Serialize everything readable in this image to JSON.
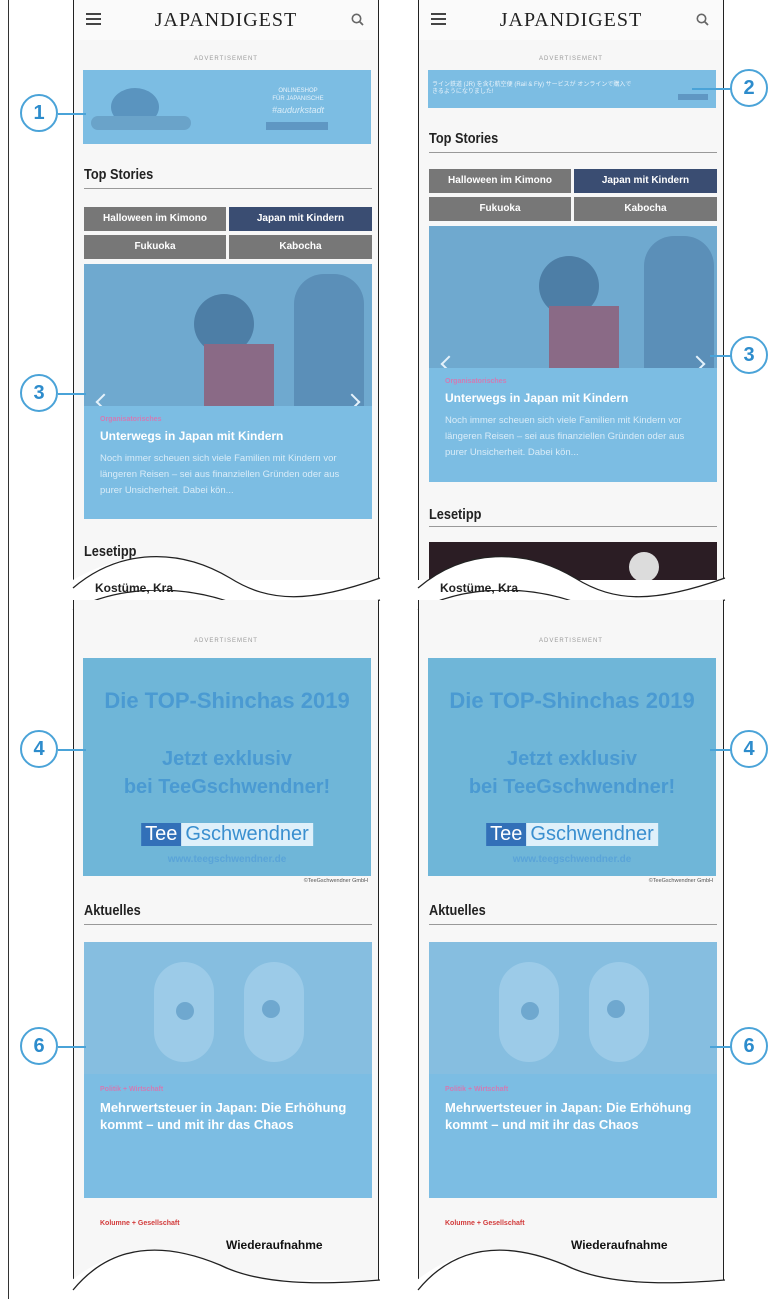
{
  "header": {
    "brand": "JAPANDIGEST",
    "ad_label": "ADVERTISEMENT"
  },
  "left_top": {
    "ad_text": "#audurkstadt",
    "ad_line1": "ONLINESHOP",
    "ad_line2": "FÜR JAPANISCHE"
  },
  "right_top": {
    "ad_text": "ライン鉄道 (JR) を含む航空便 (Rail & Fly) サービスが オンラインで購入できるようになりました!"
  },
  "top_stories": {
    "title": "Top Stories",
    "tags": [
      "Halloween im Kimono",
      "Japan mit Kindern",
      "Fukuoka",
      "Kabocha"
    ]
  },
  "story": {
    "kicker": "Organisatorisches",
    "headline": "Unterwegs in Japan mit Kindern",
    "teaser": "Noch immer scheuen sich viele Familien mit Kindern vor längeren Reisen – sei aus finanziellen Gründen oder aus purer Unsicherheit. Dabei kön..."
  },
  "lesetipp": {
    "title": "Lesetipp",
    "cut_text": "Kostüme, Kra"
  },
  "tea_ad": {
    "line1": "Die TOP-Shinchas 2019",
    "line2": "Jetzt exklusiv",
    "line3": "bei TeeGschwendner!",
    "brand_a": "Tee",
    "brand_b": "Gschwendner",
    "url": "www.teegschwendner.de",
    "copyright": "©TeeGschwendner GmbH"
  },
  "aktuelles": {
    "title": "Aktuelles",
    "kicker": "Politik + Wirtschaft",
    "headline": "Mehrwertsteuer in Japan: Die Erhöhung kommt – und mit ihr das Chaos",
    "next_kicker": "Kolumne + Gesellschaft",
    "next_headline": "Wiederaufnahme"
  },
  "callouts": {
    "c1": "1",
    "c2": "2",
    "c3": "3",
    "c4": "4",
    "c6": "6"
  },
  "colors": {
    "overlay": "#7cbde3",
    "callout": "#4aa3d8",
    "navy": "#3a4d72"
  }
}
